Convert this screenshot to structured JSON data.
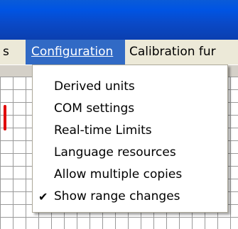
{
  "menubar": {
    "partial_left": "s",
    "configuration": "Configuration",
    "calibration": "Calibration fur"
  },
  "dropdown": {
    "items": [
      {
        "label": "Derived units",
        "checked": false
      },
      {
        "label": "COM settings",
        "checked": false
      },
      {
        "label": "Real-time Limits",
        "checked": false
      },
      {
        "label": "Language resources",
        "checked": false
      },
      {
        "label": "Allow multiple copies",
        "checked": false
      },
      {
        "label": "Show range changes",
        "checked": true
      }
    ],
    "check_glyph": "✔"
  },
  "colors": {
    "title_bar": "#0054e3",
    "menu_highlight": "#316ac5",
    "marker": "#e00000"
  }
}
